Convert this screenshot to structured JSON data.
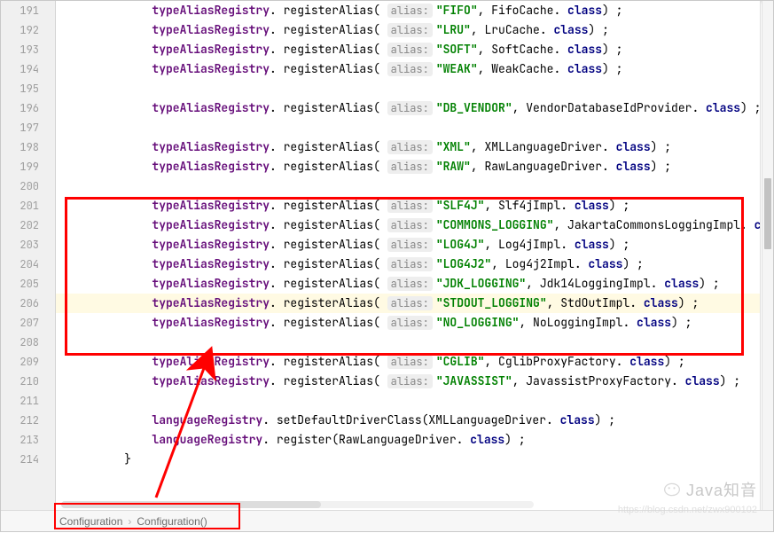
{
  "lines": [
    {
      "n": 191,
      "indent": "        ",
      "segs": [
        {
          "c": "ident",
          "t": "typeAliasRegistry"
        },
        {
          "c": "method",
          "t": ". registerAlias( "
        },
        {
          "c": "hint",
          "t": "alias:"
        },
        {
          "c": "str",
          "t": "\"FIFO\""
        },
        {
          "c": "plain",
          "t": ", FifoCache. "
        },
        {
          "c": "kw",
          "t": "class"
        },
        {
          "c": "plain",
          "t": ") ;"
        }
      ]
    },
    {
      "n": 192,
      "indent": "        ",
      "segs": [
        {
          "c": "ident",
          "t": "typeAliasRegistry"
        },
        {
          "c": "method",
          "t": ". registerAlias( "
        },
        {
          "c": "hint",
          "t": "alias:"
        },
        {
          "c": "str",
          "t": "\"LRU\""
        },
        {
          "c": "plain",
          "t": ", LruCache. "
        },
        {
          "c": "kw",
          "t": "class"
        },
        {
          "c": "plain",
          "t": ") ;"
        }
      ]
    },
    {
      "n": 193,
      "indent": "        ",
      "segs": [
        {
          "c": "ident",
          "t": "typeAliasRegistry"
        },
        {
          "c": "method",
          "t": ". registerAlias( "
        },
        {
          "c": "hint",
          "t": "alias:"
        },
        {
          "c": "str",
          "t": "\"SOFT\""
        },
        {
          "c": "plain",
          "t": ", SoftCache. "
        },
        {
          "c": "kw",
          "t": "class"
        },
        {
          "c": "plain",
          "t": ") ;"
        }
      ]
    },
    {
      "n": 194,
      "indent": "        ",
      "segs": [
        {
          "c": "ident",
          "t": "typeAliasRegistry"
        },
        {
          "c": "method",
          "t": ". registerAlias( "
        },
        {
          "c": "hint",
          "t": "alias:"
        },
        {
          "c": "str",
          "t": "\"WEAK\""
        },
        {
          "c": "plain",
          "t": ", WeakCache. "
        },
        {
          "c": "kw",
          "t": "class"
        },
        {
          "c": "plain",
          "t": ") ;"
        }
      ]
    },
    {
      "n": 195,
      "indent": "",
      "segs": []
    },
    {
      "n": 196,
      "indent": "        ",
      "segs": [
        {
          "c": "ident",
          "t": "typeAliasRegistry"
        },
        {
          "c": "method",
          "t": ". registerAlias( "
        },
        {
          "c": "hint",
          "t": "alias:"
        },
        {
          "c": "str",
          "t": "\"DB_VENDOR\""
        },
        {
          "c": "plain",
          "t": ", VendorDatabaseIdProvider. "
        },
        {
          "c": "kw",
          "t": "class"
        },
        {
          "c": "plain",
          "t": ") ;"
        }
      ]
    },
    {
      "n": 197,
      "indent": "",
      "segs": []
    },
    {
      "n": 198,
      "indent": "        ",
      "segs": [
        {
          "c": "ident",
          "t": "typeAliasRegistry"
        },
        {
          "c": "method",
          "t": ". registerAlias( "
        },
        {
          "c": "hint",
          "t": "alias:"
        },
        {
          "c": "str",
          "t": "\"XML\""
        },
        {
          "c": "plain",
          "t": ", XMLLanguageDriver. "
        },
        {
          "c": "kw",
          "t": "class"
        },
        {
          "c": "plain",
          "t": ") ;"
        }
      ]
    },
    {
      "n": 199,
      "indent": "        ",
      "segs": [
        {
          "c": "ident",
          "t": "typeAliasRegistry"
        },
        {
          "c": "method",
          "t": ". registerAlias( "
        },
        {
          "c": "hint",
          "t": "alias:"
        },
        {
          "c": "str",
          "t": "\"RAW\""
        },
        {
          "c": "plain",
          "t": ", RawLanguageDriver. "
        },
        {
          "c": "kw",
          "t": "class"
        },
        {
          "c": "plain",
          "t": ") ;"
        }
      ]
    },
    {
      "n": 200,
      "indent": "",
      "segs": []
    },
    {
      "n": 201,
      "indent": "        ",
      "segs": [
        {
          "c": "ident",
          "t": "typeAliasRegistry"
        },
        {
          "c": "method",
          "t": ". registerAlias( "
        },
        {
          "c": "hint",
          "t": "alias:"
        },
        {
          "c": "str",
          "t": "\"SLF4J\""
        },
        {
          "c": "plain",
          "t": ", Slf4jImpl. "
        },
        {
          "c": "kw",
          "t": "class"
        },
        {
          "c": "plain",
          "t": ") ;"
        }
      ]
    },
    {
      "n": 202,
      "indent": "        ",
      "segs": [
        {
          "c": "ident",
          "t": "typeAliasRegistry"
        },
        {
          "c": "method",
          "t": ". registerAlias( "
        },
        {
          "c": "hint",
          "t": "alias:"
        },
        {
          "c": "str",
          "t": "\"COMMONS_LOGGING\""
        },
        {
          "c": "plain",
          "t": ", JakartaCommonsLoggingImpl. "
        },
        {
          "c": "kw",
          "t": "class"
        },
        {
          "c": "plain",
          "t": ") ;"
        }
      ]
    },
    {
      "n": 203,
      "indent": "        ",
      "segs": [
        {
          "c": "ident",
          "t": "typeAliasRegistry"
        },
        {
          "c": "method",
          "t": ". registerAlias( "
        },
        {
          "c": "hint",
          "t": "alias:"
        },
        {
          "c": "str",
          "t": "\"LOG4J\""
        },
        {
          "c": "plain",
          "t": ", Log4jImpl. "
        },
        {
          "c": "kw",
          "t": "class"
        },
        {
          "c": "plain",
          "t": ") ;"
        }
      ]
    },
    {
      "n": 204,
      "indent": "        ",
      "segs": [
        {
          "c": "ident",
          "t": "typeAliasRegistry"
        },
        {
          "c": "method",
          "t": ". registerAlias( "
        },
        {
          "c": "hint",
          "t": "alias:"
        },
        {
          "c": "str",
          "t": "\"LOG4J2\""
        },
        {
          "c": "plain",
          "t": ", Log4j2Impl. "
        },
        {
          "c": "kw",
          "t": "class"
        },
        {
          "c": "plain",
          "t": ") ;"
        }
      ]
    },
    {
      "n": 205,
      "indent": "        ",
      "segs": [
        {
          "c": "ident",
          "t": "typeAliasRegistry"
        },
        {
          "c": "method",
          "t": ". registerAlias( "
        },
        {
          "c": "hint",
          "t": "alias:"
        },
        {
          "c": "str",
          "t": "\"JDK_LOGGING\""
        },
        {
          "c": "plain",
          "t": ", Jdk14LoggingImpl. "
        },
        {
          "c": "kw",
          "t": "class"
        },
        {
          "c": "plain",
          "t": ") ;"
        }
      ]
    },
    {
      "n": 206,
      "indent": "        ",
      "hl": true,
      "segs": [
        {
          "c": "ident",
          "t": "typeAliasRegistry"
        },
        {
          "c": "method",
          "t": ". registerAlias( "
        },
        {
          "c": "hint",
          "t": "alias:"
        },
        {
          "c": "str",
          "t": "\"STDOUT_LOGGING\""
        },
        {
          "c": "plain",
          "t": ", StdOutImpl. "
        },
        {
          "c": "kw",
          "t": "class"
        },
        {
          "c": "plain",
          "t": ") ;"
        }
      ]
    },
    {
      "n": 207,
      "indent": "        ",
      "segs": [
        {
          "c": "ident",
          "t": "typeAliasRegistry"
        },
        {
          "c": "method",
          "t": ". registerAlias( "
        },
        {
          "c": "hint",
          "t": "alias:"
        },
        {
          "c": "str",
          "t": "\"NO_LOGGING\""
        },
        {
          "c": "plain",
          "t": ", NoLoggingImpl. "
        },
        {
          "c": "kw",
          "t": "class"
        },
        {
          "c": "plain",
          "t": ") ;"
        }
      ]
    },
    {
      "n": 208,
      "indent": "",
      "segs": []
    },
    {
      "n": 209,
      "indent": "        ",
      "segs": [
        {
          "c": "ident",
          "t": "typeAliasRegistry"
        },
        {
          "c": "method",
          "t": ". registerAlias( "
        },
        {
          "c": "hint",
          "t": "alias:"
        },
        {
          "c": "str",
          "t": "\"CGLIB\""
        },
        {
          "c": "plain",
          "t": ", CglibProxyFactory. "
        },
        {
          "c": "kw",
          "t": "class"
        },
        {
          "c": "plain",
          "t": ") ;"
        }
      ]
    },
    {
      "n": 210,
      "indent": "        ",
      "segs": [
        {
          "c": "ident",
          "t": "typeAliasRegistry"
        },
        {
          "c": "method",
          "t": ". registerAlias( "
        },
        {
          "c": "hint",
          "t": "alias:"
        },
        {
          "c": "str",
          "t": "\"JAVASSIST\""
        },
        {
          "c": "plain",
          "t": ", JavassistProxyFactory. "
        },
        {
          "c": "kw",
          "t": "class"
        },
        {
          "c": "plain",
          "t": ") ;"
        }
      ]
    },
    {
      "n": 211,
      "indent": "",
      "segs": []
    },
    {
      "n": 212,
      "indent": "        ",
      "segs": [
        {
          "c": "ident",
          "t": "languageRegistry"
        },
        {
          "c": "method",
          "t": ". setDefaultDriverClass(XMLLanguageDriver. "
        },
        {
          "c": "kw",
          "t": "class"
        },
        {
          "c": "plain",
          "t": ") ;"
        }
      ]
    },
    {
      "n": 213,
      "indent": "        ",
      "segs": [
        {
          "c": "ident",
          "t": "languageRegistry"
        },
        {
          "c": "method",
          "t": ". register(RawLanguageDriver. "
        },
        {
          "c": "kw",
          "t": "class"
        },
        {
          "c": "plain",
          "t": ") ;"
        }
      ]
    },
    {
      "n": 214,
      "indent": "    ",
      "segs": [
        {
          "c": "plain",
          "t": "}"
        }
      ]
    }
  ],
  "breadcrumb": {
    "seg1": "Configuration",
    "seg2": "Configuration()"
  },
  "watermark": {
    "brand": "Java知音",
    "url": "https://blog.csdn.net/zwx900102"
  }
}
